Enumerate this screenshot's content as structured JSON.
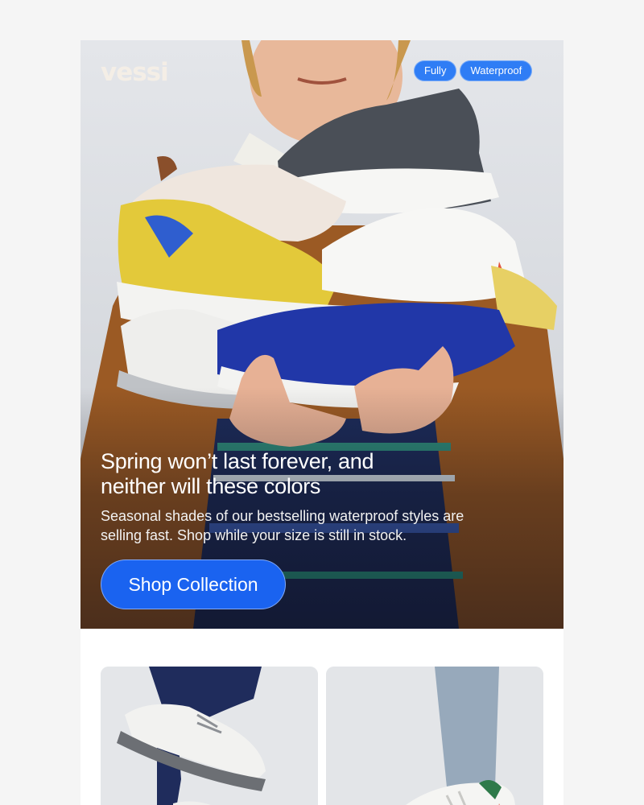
{
  "brand": {
    "logo_text": "vessi"
  },
  "hero": {
    "badges": [
      "Fully",
      "Waterproof"
    ],
    "headline_line1": "Spring won’t last forever, and",
    "headline_line2": "neither will these colors",
    "subcopy_line1": "Seasonal shades of our bestselling waterproof styles are",
    "subcopy_line2": "selling fast. Shop while your size is still in stock.",
    "cta_label": "Shop Collection"
  },
  "colors": {
    "accent_blue": "#1a63f0",
    "badge_blue": "#2f7df5",
    "logo_cream": "#f4eee6",
    "page_bg": "#f5f5f5"
  },
  "icons": {
    "hero_image": "person-holding-sneakers-image",
    "tile_left_image": "white-sneaker-on-foot-image",
    "tile_right_image": "white-sneaker-with-jeans-image"
  }
}
